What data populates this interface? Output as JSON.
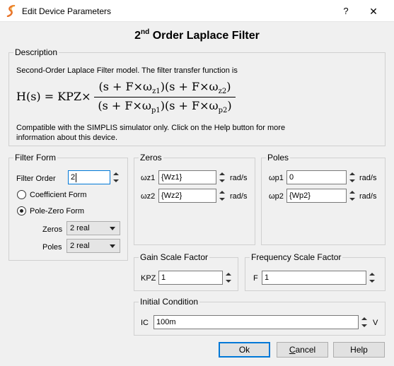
{
  "window": {
    "title": "Edit Device Parameters",
    "help_glyph": "?",
    "close_glyph": "✕"
  },
  "heading": {
    "prefix": "2",
    "sup": "nd",
    "rest": " Order Laplace Filter"
  },
  "description": {
    "group_title": "Description",
    "intro": "Second-Order Laplace Filter model. The filter transfer function is",
    "formula": {
      "lhs": "H(s) = KPZ×",
      "numerator_a": "(s + F×ω",
      "numerator_a_sub": "z1",
      "numerator_b": ")(s + F×ω",
      "numerator_b_sub": "z2",
      "numerator_end": ")",
      "denominator_a": "(s + F×ω",
      "denominator_a_sub": "p1",
      "denominator_b": ")(s + F×ω",
      "denominator_b_sub": "p2",
      "denominator_end": ")"
    },
    "compat_line1": "Compatible with the SIMPLIS simulator only. Click on the Help button for more",
    "compat_line2": "information about this device."
  },
  "filter_form": {
    "group_title": "Filter Form",
    "order_label": "Filter Order",
    "order_value": "2",
    "coefficient_label": "Coefficient Form",
    "pole_zero_label": "Pole-Zero Form",
    "selected": "pole-zero",
    "zeros_label": "Zeros",
    "zeros_value": "2 real",
    "poles_label": "Poles",
    "poles_value": "2 real"
  },
  "zeros": {
    "group_title": "Zeros",
    "wz1_label": "ωz1",
    "wz1_value": "{Wz1}",
    "wz1_unit": "rad/s",
    "wz2_label": "ωz2",
    "wz2_value": "{Wz2}",
    "wz2_unit": "rad/s"
  },
  "poles": {
    "group_title": "Poles",
    "wp1_label": "ωp1",
    "wp1_value": "0",
    "wp1_unit": "rad/s",
    "wp2_label": "ωp2",
    "wp2_value": "{Wp2}",
    "wp2_unit": "rad/s"
  },
  "gain": {
    "group_title": "Gain Scale Factor",
    "label": "KPZ",
    "value": "1"
  },
  "freq": {
    "group_title": "Frequency Scale Factor",
    "label": "F",
    "value": "1"
  },
  "initial": {
    "group_title": "Initial Condition",
    "label": "IC",
    "value": "100m",
    "unit": "V"
  },
  "buttons": {
    "ok": "Ok",
    "cancel_u": "C",
    "cancel_rest": "ancel",
    "help": "Help"
  },
  "colors": {
    "focus_accent": "#0078d7",
    "app_icon_accent": "#e8742a"
  }
}
